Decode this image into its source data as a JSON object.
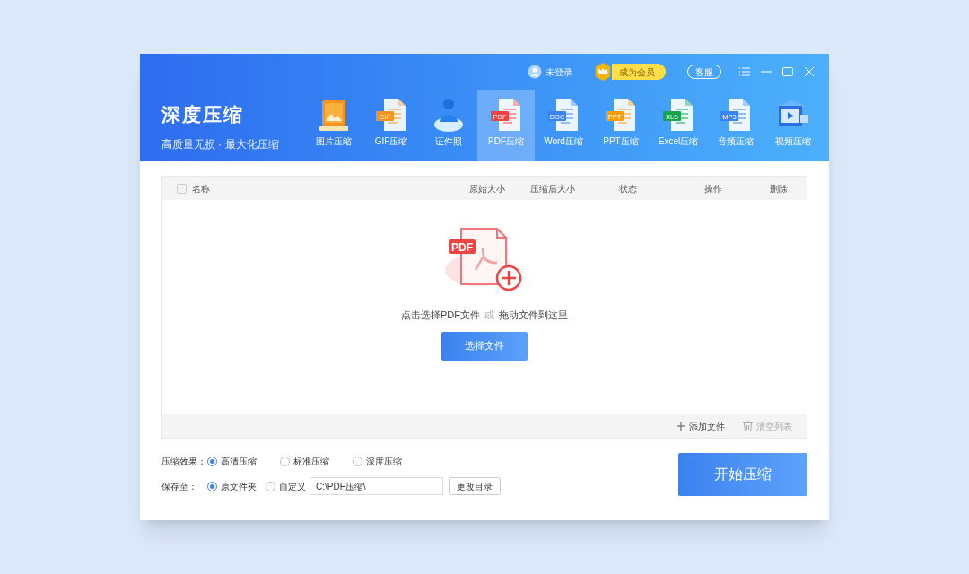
{
  "app": {
    "title": "深度压缩",
    "subtitle": "高质量无损 · 最大化压缩"
  },
  "topbar": {
    "login": "未登录",
    "vip": "成为会员",
    "service": "客服"
  },
  "tools": [
    {
      "label": "图片压缩",
      "kind": "image",
      "selected": false
    },
    {
      "label": "GIF压缩",
      "kind": "doc",
      "badge": "GIF",
      "color": "#f7931e",
      "selected": false
    },
    {
      "label": "证件照",
      "kind": "person",
      "selected": false
    },
    {
      "label": "PDF压缩",
      "kind": "doc",
      "badge": "PDF",
      "color": "#ef4444",
      "selected": true
    },
    {
      "label": "Word压缩",
      "kind": "doc",
      "badge": "DOC",
      "color": "#3b82f6",
      "selected": false
    },
    {
      "label": "PPT压缩",
      "kind": "doc",
      "badge": "PPT",
      "color": "#f59e0b",
      "selected": false
    },
    {
      "label": "Excel压缩",
      "kind": "doc",
      "badge": "XLS",
      "color": "#16a34a",
      "selected": false
    },
    {
      "label": "音频压缩",
      "kind": "doc",
      "badge": "MP3",
      "color": "#3b82f6",
      "selected": false
    },
    {
      "label": "视频压缩",
      "kind": "video",
      "selected": false
    }
  ],
  "table": {
    "select_all": false,
    "columns": [
      "名称",
      "原始大小",
      "压缩后大小",
      "状态",
      "操作",
      "删除"
    ]
  },
  "empty": {
    "badge": "PDF",
    "hint_a": "点击选择PDF文件",
    "or": "或",
    "hint_b": "拖动文件到这里",
    "button": "选择文件"
  },
  "footer": {
    "add": "添加文件",
    "clear": "清空列表"
  },
  "options": {
    "effect_label": "压缩效果：",
    "effects": [
      {
        "label": "高清压缩",
        "selected": true
      },
      {
        "label": "标准压缩",
        "selected": false
      },
      {
        "label": "深度压缩",
        "selected": false
      }
    ],
    "save_label": "保存至：",
    "saves": [
      {
        "label": "原文件夹",
        "selected": true
      },
      {
        "label": "自定义",
        "selected": false
      }
    ],
    "path": "C:\\PDF压缩\\",
    "change_dir": "更改目录"
  },
  "start": "开始压缩"
}
